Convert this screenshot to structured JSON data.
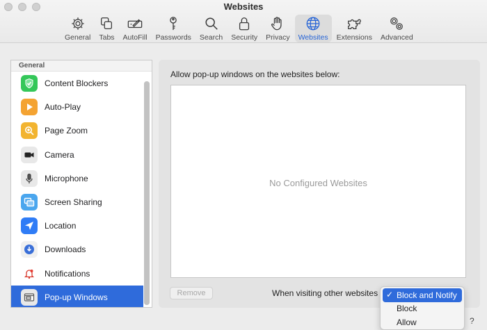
{
  "window": {
    "title": "Websites"
  },
  "toolbar": {
    "items": [
      {
        "label": "General",
        "icon": "gear-icon"
      },
      {
        "label": "Tabs",
        "icon": "tabs-icon"
      },
      {
        "label": "AutoFill",
        "icon": "autofill-icon"
      },
      {
        "label": "Passwords",
        "icon": "key-icon"
      },
      {
        "label": "Search",
        "icon": "search-icon"
      },
      {
        "label": "Security",
        "icon": "lock-icon"
      },
      {
        "label": "Privacy",
        "icon": "hand-icon"
      },
      {
        "label": "Websites",
        "icon": "globe-icon",
        "active": true
      },
      {
        "label": "Extensions",
        "icon": "puzzle-icon"
      },
      {
        "label": "Advanced",
        "icon": "gears-icon"
      }
    ]
  },
  "sidebar": {
    "section": "General",
    "items": [
      {
        "label": "Content Blockers",
        "icon": "shield-check-icon",
        "color": "#34c759"
      },
      {
        "label": "Auto-Play",
        "icon": "play-icon",
        "color": "#f4a332"
      },
      {
        "label": "Page Zoom",
        "icon": "zoom-icon",
        "color": "#f2b430"
      },
      {
        "label": "Camera",
        "icon": "camera-icon",
        "color": "#e8e8e8"
      },
      {
        "label": "Microphone",
        "icon": "microphone-icon",
        "color": "#e8e8e8"
      },
      {
        "label": "Screen Sharing",
        "icon": "screen-sharing-icon",
        "color": "#4aa6ee"
      },
      {
        "label": "Location",
        "icon": "location-icon",
        "color": "#2f7cf6"
      },
      {
        "label": "Downloads",
        "icon": "download-icon",
        "color": "#3a6fd8"
      },
      {
        "label": "Notifications",
        "icon": "bell-icon",
        "color": "#ffffff"
      },
      {
        "label": "Pop-up Windows",
        "icon": "popup-window-icon",
        "color": "#e8e8e8",
        "selected": true
      }
    ]
  },
  "main": {
    "heading": "Allow pop-up windows on the websites below:",
    "empty_message": "No Configured Websites",
    "remove_label": "Remove",
    "visiting_label": "When visiting other websites",
    "menu": {
      "options": [
        {
          "label": "Block and Notify",
          "selected": true
        },
        {
          "label": "Block"
        },
        {
          "label": "Allow"
        }
      ]
    },
    "help_label": "?"
  },
  "colors": {
    "accent": "#2f6bdb",
    "pane": "#e3e3e3"
  }
}
